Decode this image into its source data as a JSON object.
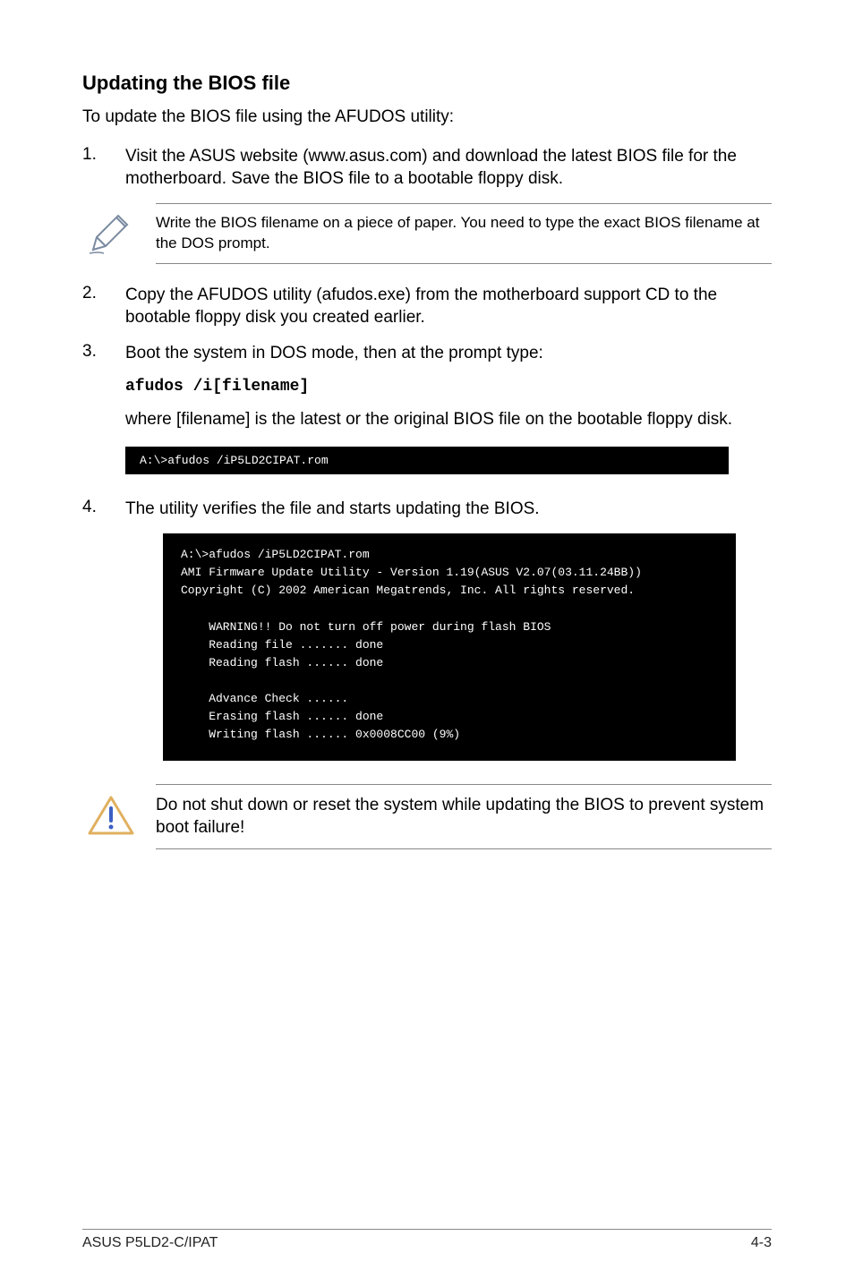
{
  "heading": "Updating the BIOS file",
  "intro": "To update the BIOS file using the AFUDOS utility:",
  "step1": {
    "num": "1.",
    "text": "Visit the ASUS website (www.asus.com) and download the latest BIOS file for the motherboard. Save the BIOS file to a bootable floppy disk."
  },
  "note1": "Write the BIOS filename on a piece of paper. You need to type the exact BIOS filename at the DOS prompt.",
  "step2": {
    "num": "2.",
    "text": "Copy the AFUDOS utility (afudos.exe) from the motherboard support CD to the bootable floppy disk you created earlier."
  },
  "step3": {
    "num": "3.",
    "text": "Boot the system in DOS mode, then at the prompt type:"
  },
  "cmd": "afudos /i[filename]",
  "step3b": "where [filename] is the latest or the original BIOS file on the bootable floppy disk.",
  "term1": "A:\\>afudos /iP5LD2CIPAT.rom",
  "step4": {
    "num": "4.",
    "text": "The utility verifies the file and starts updating the BIOS."
  },
  "term2": "A:\\>afudos /iP5LD2CIPAT.rom\nAMI Firmware Update Utility - Version 1.19(ASUS V2.07(03.11.24BB))\nCopyright (C) 2002 American Megatrends, Inc. All rights reserved.\n\n    WARNING!! Do not turn off power during flash BIOS\n    Reading file ....... done\n    Reading flash ...... done\n\n    Advance Check ......\n    Erasing flash ...... done\n    Writing flash ...... 0x0008CC00 (9%)",
  "warn": "Do not shut down or reset the system while updating the BIOS to prevent system boot failure!",
  "footer_left": "ASUS P5LD2-C/IPAT",
  "footer_right": "4-3"
}
